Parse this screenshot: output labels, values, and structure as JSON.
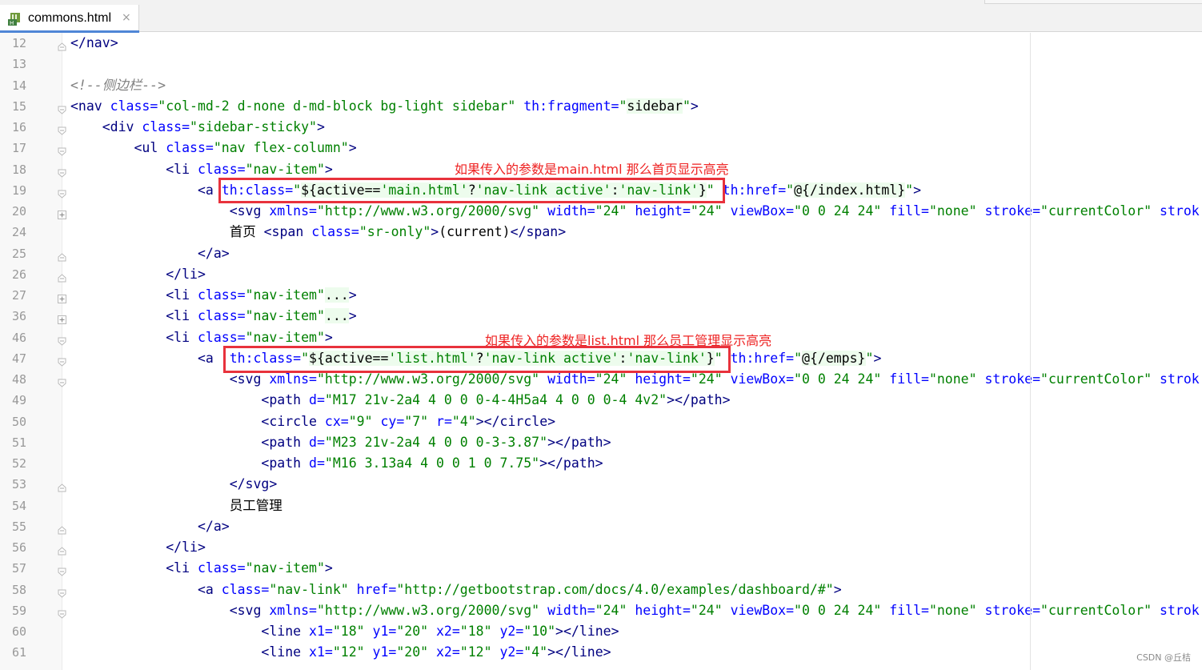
{
  "tab": {
    "filename": "commons.html",
    "close_glyph": "×"
  },
  "lines": [
    {
      "num": "12",
      "tokens": [
        {
          "t": "t",
          "s": "</"
        },
        {
          "t": "t",
          "s": "nav"
        },
        {
          "t": "t",
          "s": ">"
        }
      ]
    },
    {
      "num": "13",
      "tokens": []
    },
    {
      "num": "14",
      "tokens": [
        {
          "t": "c",
          "s": "<!--侧边栏-->"
        }
      ]
    },
    {
      "num": "15",
      "tokens": [
        {
          "t": "t",
          "s": "<nav "
        },
        {
          "t": "a",
          "s": "class="
        },
        {
          "t": "v",
          "s": "\"col-md-2 d-none d-md-block bg-light sidebar\" "
        },
        {
          "t": "a",
          "s": "th:fragment="
        },
        {
          "t": "v",
          "s": "\""
        },
        {
          "t": "e",
          "h": true,
          "s": "sidebar"
        },
        {
          "t": "v",
          "s": "\""
        },
        {
          "t": "t",
          "s": ">"
        }
      ]
    },
    {
      "num": "16",
      "tokens": [
        {
          "t": "e",
          "s": "    "
        },
        {
          "t": "t",
          "s": "<div "
        },
        {
          "t": "a",
          "s": "class="
        },
        {
          "t": "v",
          "s": "\"sidebar-sticky\""
        },
        {
          "t": "t",
          "s": ">"
        }
      ]
    },
    {
      "num": "17",
      "tokens": [
        {
          "t": "e",
          "s": "        "
        },
        {
          "t": "t",
          "s": "<ul "
        },
        {
          "t": "a",
          "s": "class="
        },
        {
          "t": "v",
          "s": "\"nav flex-column\""
        },
        {
          "t": "t",
          "s": ">"
        }
      ]
    },
    {
      "num": "18",
      "tokens": [
        {
          "t": "e",
          "s": "            "
        },
        {
          "t": "t",
          "s": "<li "
        },
        {
          "t": "a",
          "s": "class="
        },
        {
          "t": "v",
          "s": "\"nav-item\""
        },
        {
          "t": "t",
          "s": ">"
        }
      ]
    },
    {
      "num": "19",
      "tokens": [
        {
          "t": "e",
          "s": "                "
        },
        {
          "t": "t",
          "s": "<a "
        },
        {
          "t": "a",
          "s": "th:class="
        },
        {
          "t": "v",
          "s": "\""
        },
        {
          "t": "e",
          "h": true,
          "s": "${active=="
        },
        {
          "t": "v",
          "h": true,
          "s": "'main.html'"
        },
        {
          "t": "e",
          "h": true,
          "s": "?"
        },
        {
          "t": "v",
          "h": true,
          "s": "'nav-link active'"
        },
        {
          "t": "e",
          "h": true,
          "s": ":"
        },
        {
          "t": "v",
          "h": true,
          "s": "'nav-link'"
        },
        {
          "t": "e",
          "h": true,
          "s": "}"
        },
        {
          "t": "v",
          "s": "\" "
        },
        {
          "t": "a",
          "s": "th:href="
        },
        {
          "t": "v",
          "s": "\""
        },
        {
          "t": "e",
          "h": true,
          "s": "@{/index.html}"
        },
        {
          "t": "v",
          "s": "\""
        },
        {
          "t": "t",
          "s": ">"
        }
      ]
    },
    {
      "num": "20",
      "tokens": [
        {
          "t": "e",
          "s": "                    "
        },
        {
          "t": "t",
          "s": "<svg "
        },
        {
          "t": "a",
          "s": "xmlns="
        },
        {
          "t": "v",
          "s": "\"http://www.w3.org/2000/svg\" "
        },
        {
          "t": "a",
          "s": "width="
        },
        {
          "t": "v",
          "s": "\"24\" "
        },
        {
          "t": "a",
          "s": "height="
        },
        {
          "t": "v",
          "s": "\"24\" "
        },
        {
          "t": "a",
          "s": "viewBox="
        },
        {
          "t": "v",
          "s": "\"0 0 24 24\" "
        },
        {
          "t": "a",
          "s": "fill="
        },
        {
          "t": "v",
          "s": "\"none\" "
        },
        {
          "t": "a",
          "s": "stroke="
        },
        {
          "t": "v",
          "s": "\"currentColor\" "
        },
        {
          "t": "a",
          "s": "strok"
        }
      ]
    },
    {
      "num": "24",
      "tokens": [
        {
          "t": "e",
          "s": "                    "
        },
        {
          "t": "e",
          "cjk": true,
          "s": "首页"
        },
        {
          "t": "e",
          "s": " "
        },
        {
          "t": "t",
          "s": "<span "
        },
        {
          "t": "a",
          "s": "class="
        },
        {
          "t": "v",
          "s": "\"sr-only\""
        },
        {
          "t": "t",
          "s": ">"
        },
        {
          "t": "e",
          "s": "(current)"
        },
        {
          "t": "t",
          "s": "</span>"
        }
      ]
    },
    {
      "num": "25",
      "tokens": [
        {
          "t": "e",
          "s": "                "
        },
        {
          "t": "t",
          "s": "</a>"
        }
      ]
    },
    {
      "num": "26",
      "tokens": [
        {
          "t": "e",
          "s": "            "
        },
        {
          "t": "t",
          "s": "</li>"
        }
      ]
    },
    {
      "num": "27",
      "tokens": [
        {
          "t": "e",
          "s": "            "
        },
        {
          "t": "t",
          "s": "<li "
        },
        {
          "t": "a",
          "s": "class="
        },
        {
          "t": "v",
          "s": "\"nav-item\""
        },
        {
          "t": "e",
          "h": true,
          "s": "..."
        },
        {
          "t": "t",
          "s": ">"
        }
      ]
    },
    {
      "num": "36",
      "tokens": [
        {
          "t": "e",
          "s": "            "
        },
        {
          "t": "t",
          "s": "<li "
        },
        {
          "t": "a",
          "s": "class="
        },
        {
          "t": "v",
          "s": "\"nav-item\""
        },
        {
          "t": "e",
          "h": true,
          "s": "..."
        },
        {
          "t": "t",
          "s": ">"
        }
      ]
    },
    {
      "num": "46",
      "tokens": [
        {
          "t": "e",
          "s": "            "
        },
        {
          "t": "t",
          "s": "<li "
        },
        {
          "t": "a",
          "s": "class="
        },
        {
          "t": "v",
          "s": "\"nav-item\""
        },
        {
          "t": "t",
          "s": ">"
        }
      ]
    },
    {
      "num": "47",
      "tokens": [
        {
          "t": "e",
          "s": "                "
        },
        {
          "t": "t",
          "s": "<a  "
        },
        {
          "t": "a",
          "s": "th:class="
        },
        {
          "t": "v",
          "s": "\""
        },
        {
          "t": "e",
          "h": true,
          "s": "${active=="
        },
        {
          "t": "v",
          "h": true,
          "s": "'list.html'"
        },
        {
          "t": "e",
          "h": true,
          "s": "?"
        },
        {
          "t": "v",
          "h": true,
          "s": "'nav-link active'"
        },
        {
          "t": "e",
          "h": true,
          "s": ":"
        },
        {
          "t": "v",
          "h": true,
          "s": "'nav-link'"
        },
        {
          "t": "e",
          "h": true,
          "s": "}"
        },
        {
          "t": "v",
          "s": "\" "
        },
        {
          "t": "a",
          "s": "th:href="
        },
        {
          "t": "v",
          "s": "\""
        },
        {
          "t": "e",
          "h": true,
          "s": "@{/emps}"
        },
        {
          "t": "v",
          "s": "\""
        },
        {
          "t": "t",
          "s": ">"
        }
      ]
    },
    {
      "num": "48",
      "tokens": [
        {
          "t": "e",
          "s": "                    "
        },
        {
          "t": "t",
          "s": "<svg "
        },
        {
          "t": "a",
          "s": "xmlns="
        },
        {
          "t": "v",
          "s": "\"http://www.w3.org/2000/svg\" "
        },
        {
          "t": "a",
          "s": "width="
        },
        {
          "t": "v",
          "s": "\"24\" "
        },
        {
          "t": "a",
          "s": "height="
        },
        {
          "t": "v",
          "s": "\"24\" "
        },
        {
          "t": "a",
          "s": "viewBox="
        },
        {
          "t": "v",
          "s": "\"0 0 24 24\" "
        },
        {
          "t": "a",
          "s": "fill="
        },
        {
          "t": "v",
          "s": "\"none\" "
        },
        {
          "t": "a",
          "s": "stroke="
        },
        {
          "t": "v",
          "s": "\"currentColor\" "
        },
        {
          "t": "a",
          "s": "strok"
        }
      ]
    },
    {
      "num": "49",
      "tokens": [
        {
          "t": "e",
          "s": "                        "
        },
        {
          "t": "t",
          "s": "<path "
        },
        {
          "t": "a",
          "s": "d="
        },
        {
          "t": "v",
          "s": "\"M17 21v-2a4 4 0 0 0-4-4H5a4 4 0 0 0-4 4v2\""
        },
        {
          "t": "t",
          "s": "></path>"
        }
      ]
    },
    {
      "num": "50",
      "tokens": [
        {
          "t": "e",
          "s": "                        "
        },
        {
          "t": "t",
          "s": "<circle "
        },
        {
          "t": "a",
          "s": "cx="
        },
        {
          "t": "v",
          "s": "\"9\" "
        },
        {
          "t": "a",
          "s": "cy="
        },
        {
          "t": "v",
          "s": "\"7\" "
        },
        {
          "t": "a",
          "s": "r="
        },
        {
          "t": "v",
          "s": "\"4\""
        },
        {
          "t": "t",
          "s": "></circle>"
        }
      ]
    },
    {
      "num": "51",
      "tokens": [
        {
          "t": "e",
          "s": "                        "
        },
        {
          "t": "t",
          "s": "<path "
        },
        {
          "t": "a",
          "s": "d="
        },
        {
          "t": "v",
          "s": "\"M23 21v-2a4 4 0 0 0-3-3.87\""
        },
        {
          "t": "t",
          "s": "></path>"
        }
      ]
    },
    {
      "num": "52",
      "tokens": [
        {
          "t": "e",
          "s": "                        "
        },
        {
          "t": "t",
          "s": "<path "
        },
        {
          "t": "a",
          "s": "d="
        },
        {
          "t": "v",
          "s": "\"M16 3.13a4 4 0 0 1 0 7.75\""
        },
        {
          "t": "t",
          "s": "></path>"
        }
      ]
    },
    {
      "num": "53",
      "tokens": [
        {
          "t": "e",
          "s": "                    "
        },
        {
          "t": "t",
          "s": "</svg>"
        }
      ]
    },
    {
      "num": "54",
      "tokens": [
        {
          "t": "e",
          "s": "                    "
        },
        {
          "t": "e",
          "cjk": true,
          "s": "员工管理"
        }
      ]
    },
    {
      "num": "55",
      "tokens": [
        {
          "t": "e",
          "s": "                "
        },
        {
          "t": "t",
          "s": "</a>"
        }
      ]
    },
    {
      "num": "56",
      "tokens": [
        {
          "t": "e",
          "s": "            "
        },
        {
          "t": "t",
          "s": "</li>"
        }
      ]
    },
    {
      "num": "57",
      "tokens": [
        {
          "t": "e",
          "s": "            "
        },
        {
          "t": "t",
          "s": "<li "
        },
        {
          "t": "a",
          "s": "class="
        },
        {
          "t": "v",
          "s": "\"nav-item\""
        },
        {
          "t": "t",
          "s": ">"
        }
      ]
    },
    {
      "num": "58",
      "tokens": [
        {
          "t": "e",
          "s": "                "
        },
        {
          "t": "t",
          "s": "<a "
        },
        {
          "t": "a",
          "s": "class="
        },
        {
          "t": "v",
          "s": "\"nav-link\" "
        },
        {
          "t": "a",
          "s": "href="
        },
        {
          "t": "v",
          "s": "\"http://getbootstrap.com/docs/4.0/examples/dashboard/#\""
        },
        {
          "t": "t",
          "s": ">"
        }
      ]
    },
    {
      "num": "59",
      "tokens": [
        {
          "t": "e",
          "s": "                    "
        },
        {
          "t": "t",
          "s": "<svg "
        },
        {
          "t": "a",
          "s": "xmlns="
        },
        {
          "t": "v",
          "s": "\"http://www.w3.org/2000/svg\" "
        },
        {
          "t": "a",
          "s": "width="
        },
        {
          "t": "v",
          "s": "\"24\" "
        },
        {
          "t": "a",
          "s": "height="
        },
        {
          "t": "v",
          "s": "\"24\" "
        },
        {
          "t": "a",
          "s": "viewBox="
        },
        {
          "t": "v",
          "s": "\"0 0 24 24\" "
        },
        {
          "t": "a",
          "s": "fill="
        },
        {
          "t": "v",
          "s": "\"none\" "
        },
        {
          "t": "a",
          "s": "stroke="
        },
        {
          "t": "v",
          "s": "\"currentColor\" "
        },
        {
          "t": "a",
          "s": "strok"
        }
      ]
    },
    {
      "num": "60",
      "tokens": [
        {
          "t": "e",
          "s": "                        "
        },
        {
          "t": "t",
          "s": "<line "
        },
        {
          "t": "a",
          "s": "x1="
        },
        {
          "t": "v",
          "s": "\"18\" "
        },
        {
          "t": "a",
          "s": "y1="
        },
        {
          "t": "v",
          "s": "\"20\" "
        },
        {
          "t": "a",
          "s": "x2="
        },
        {
          "t": "v",
          "s": "\"18\" "
        },
        {
          "t": "a",
          "s": "y2="
        },
        {
          "t": "v",
          "s": "\"10\""
        },
        {
          "t": "t",
          "s": "></line>"
        }
      ]
    },
    {
      "num": "61",
      "tokens": [
        {
          "t": "e",
          "s": "                        "
        },
        {
          "t": "t",
          "s": "<line "
        },
        {
          "t": "a",
          "s": "x1="
        },
        {
          "t": "v",
          "s": "\"12\" "
        },
        {
          "t": "a",
          "s": "y1="
        },
        {
          "t": "v",
          "s": "\"20\" "
        },
        {
          "t": "a",
          "s": "x2="
        },
        {
          "t": "v",
          "s": "\"12\" "
        },
        {
          "t": "a",
          "s": "y2="
        },
        {
          "t": "v",
          "s": "\"4\""
        },
        {
          "t": "t",
          "s": "></line>"
        }
      ]
    }
  ],
  "annotations": {
    "first": "如果传入的参数是main.html 那么首页显示高亮",
    "second": "如果传入的参数是list.html 那么员工管理显示高亮"
  },
  "watermark": "CSDN @丘桔",
  "colors": {
    "tag": "#000080",
    "attr": "#0000ff",
    "value": "#008000",
    "comment": "#808080",
    "highlight_box": "#e8323c",
    "tab_accent": "#4f86d6"
  }
}
